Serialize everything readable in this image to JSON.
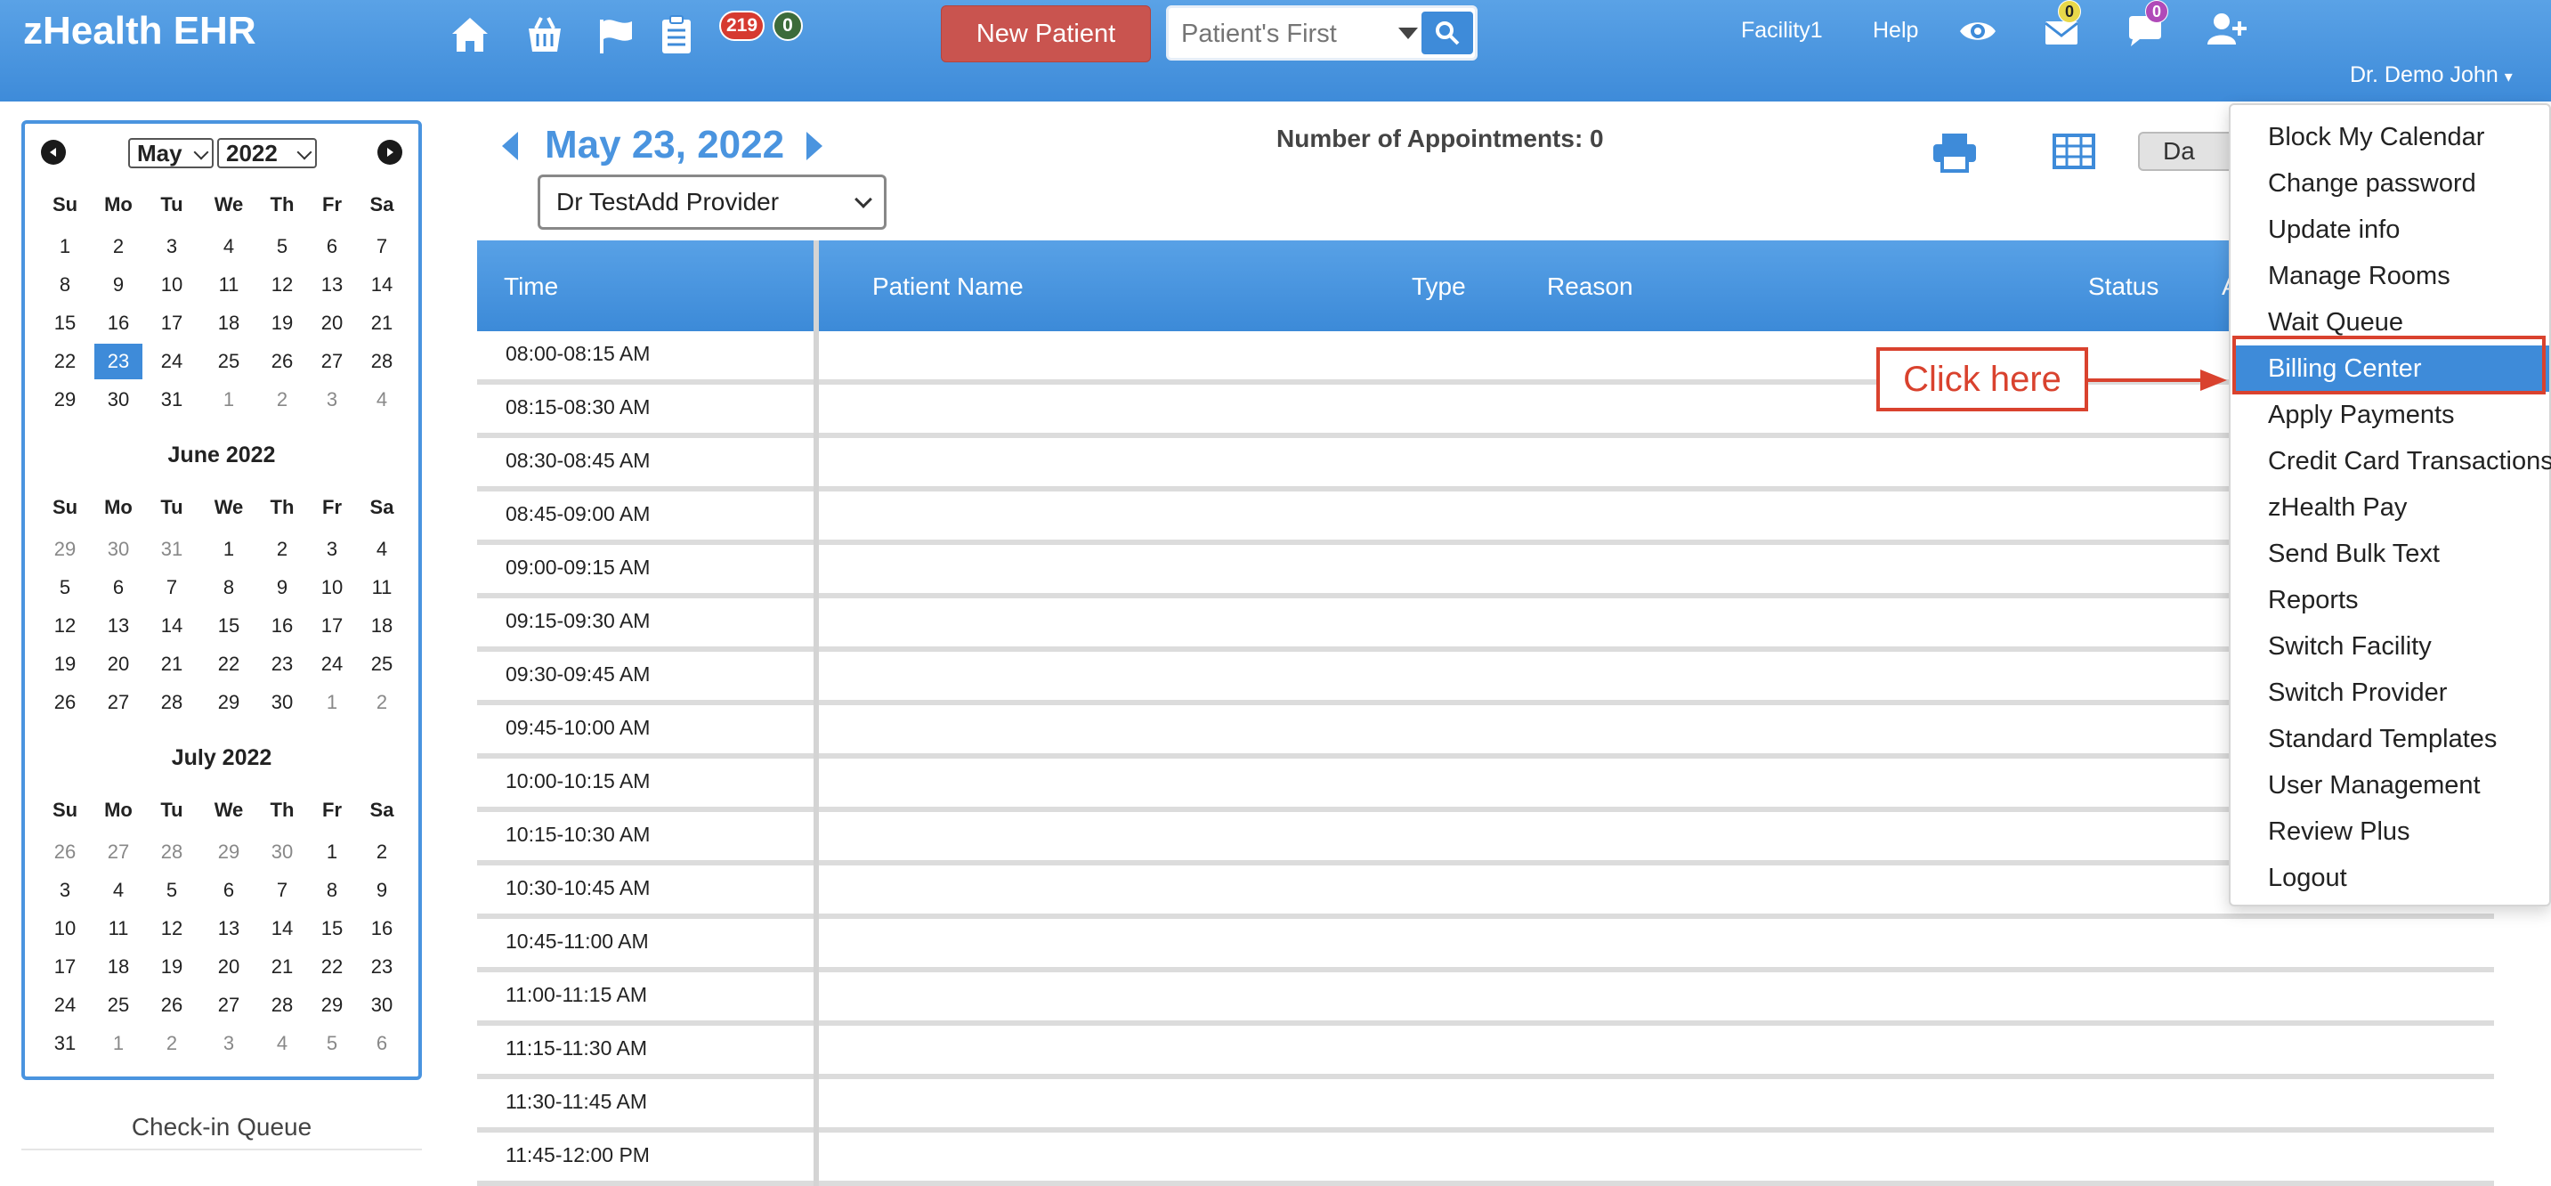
{
  "header": {
    "app_title": "zHealth EHR",
    "icons": [
      "home-icon",
      "basket-icon",
      "flag-icon",
      "clipboard-icon",
      "eye-icon",
      "envelope-icon",
      "chat-icon",
      "add-user-icon"
    ],
    "badge_red": "219",
    "badge_green": "0",
    "new_patient_label": "New Patient",
    "search_placeholder": "Patient's First",
    "facility_label": "Facility1",
    "help_label": "Help",
    "mail_badge": "0",
    "chat_badge": "0",
    "user_name": "Dr. Demo John"
  },
  "mini_calendar": {
    "selected_month": "May",
    "selected_year": "2022",
    "weekdays": [
      "Su",
      "Mo",
      "Tu",
      "We",
      "Th",
      "Fr",
      "Sa"
    ],
    "months": [
      {
        "title": "",
        "weeks": [
          [
            "1",
            "2",
            "3",
            "4",
            "5",
            "6",
            "7"
          ],
          [
            "8",
            "9",
            "10",
            "11",
            "12",
            "13",
            "14"
          ],
          [
            "15",
            "16",
            "17",
            "18",
            "19",
            "20",
            "21"
          ],
          [
            "22",
            "23",
            "24",
            "25",
            "26",
            "27",
            "28"
          ],
          [
            "29",
            "30",
            "31",
            "1",
            "2",
            "3",
            "4"
          ]
        ]
      },
      {
        "title": "June 2022",
        "weeks": [
          [
            "29",
            "30",
            "31",
            "1",
            "2",
            "3",
            "4"
          ],
          [
            "5",
            "6",
            "7",
            "8",
            "9",
            "10",
            "11"
          ],
          [
            "12",
            "13",
            "14",
            "15",
            "16",
            "17",
            "18"
          ],
          [
            "19",
            "20",
            "21",
            "22",
            "23",
            "24",
            "25"
          ],
          [
            "26",
            "27",
            "28",
            "29",
            "30",
            "1",
            "2"
          ]
        ]
      },
      {
        "title": "July 2022",
        "weeks": [
          [
            "26",
            "27",
            "28",
            "29",
            "30",
            "1",
            "2"
          ],
          [
            "3",
            "4",
            "5",
            "6",
            "7",
            "8",
            "9"
          ],
          [
            "10",
            "11",
            "12",
            "13",
            "14",
            "15",
            "16"
          ],
          [
            "17",
            "18",
            "19",
            "20",
            "21",
            "22",
            "23"
          ],
          [
            "24",
            "25",
            "26",
            "27",
            "28",
            "29",
            "30"
          ],
          [
            "31",
            "1",
            "2",
            "3",
            "4",
            "5",
            "6"
          ]
        ]
      }
    ],
    "selected_day": "23",
    "checkin_queue_title": "Check-in Queue"
  },
  "main": {
    "date_title": "May 23, 2022",
    "appointments_label": "Number of Appointments: 0",
    "provider": "Dr TestAdd Provider",
    "view_toggle_label": "Da",
    "columns": [
      "Time",
      "Patient Name",
      "Type",
      "Reason",
      "Status",
      "A"
    ],
    "time_slots": [
      "08:00-08:15 AM",
      "08:15-08:30 AM",
      "08:30-08:45 AM",
      "08:45-09:00 AM",
      "09:00-09:15 AM",
      "09:15-09:30 AM",
      "09:30-09:45 AM",
      "09:45-10:00 AM",
      "10:00-10:15 AM",
      "10:15-10:30 AM",
      "10:30-10:45 AM",
      "10:45-11:00 AM",
      "11:00-11:15 AM",
      "11:15-11:30 AM",
      "11:30-11:45 AM",
      "11:45-12:00 PM"
    ]
  },
  "user_menu": {
    "items": [
      "Block My Calendar",
      "Change password",
      "Update info",
      "Manage Rooms",
      "Wait Queue",
      "Billing Center",
      "Apply Payments",
      "Credit Card Transactions",
      "zHealth Pay",
      "Send Bulk Text",
      "Reports",
      "Switch Facility",
      "Switch Provider",
      "Standard Templates",
      "User Management",
      "Review Plus",
      "Logout"
    ],
    "active_item": "Billing Center"
  },
  "annotation": {
    "callout_text": "Click here",
    "color": "#d9422e"
  },
  "colors": {
    "header_blue": "#3e8bd9",
    "new_patient_red": "#c9544f",
    "accent_blue": "#4a94df"
  }
}
